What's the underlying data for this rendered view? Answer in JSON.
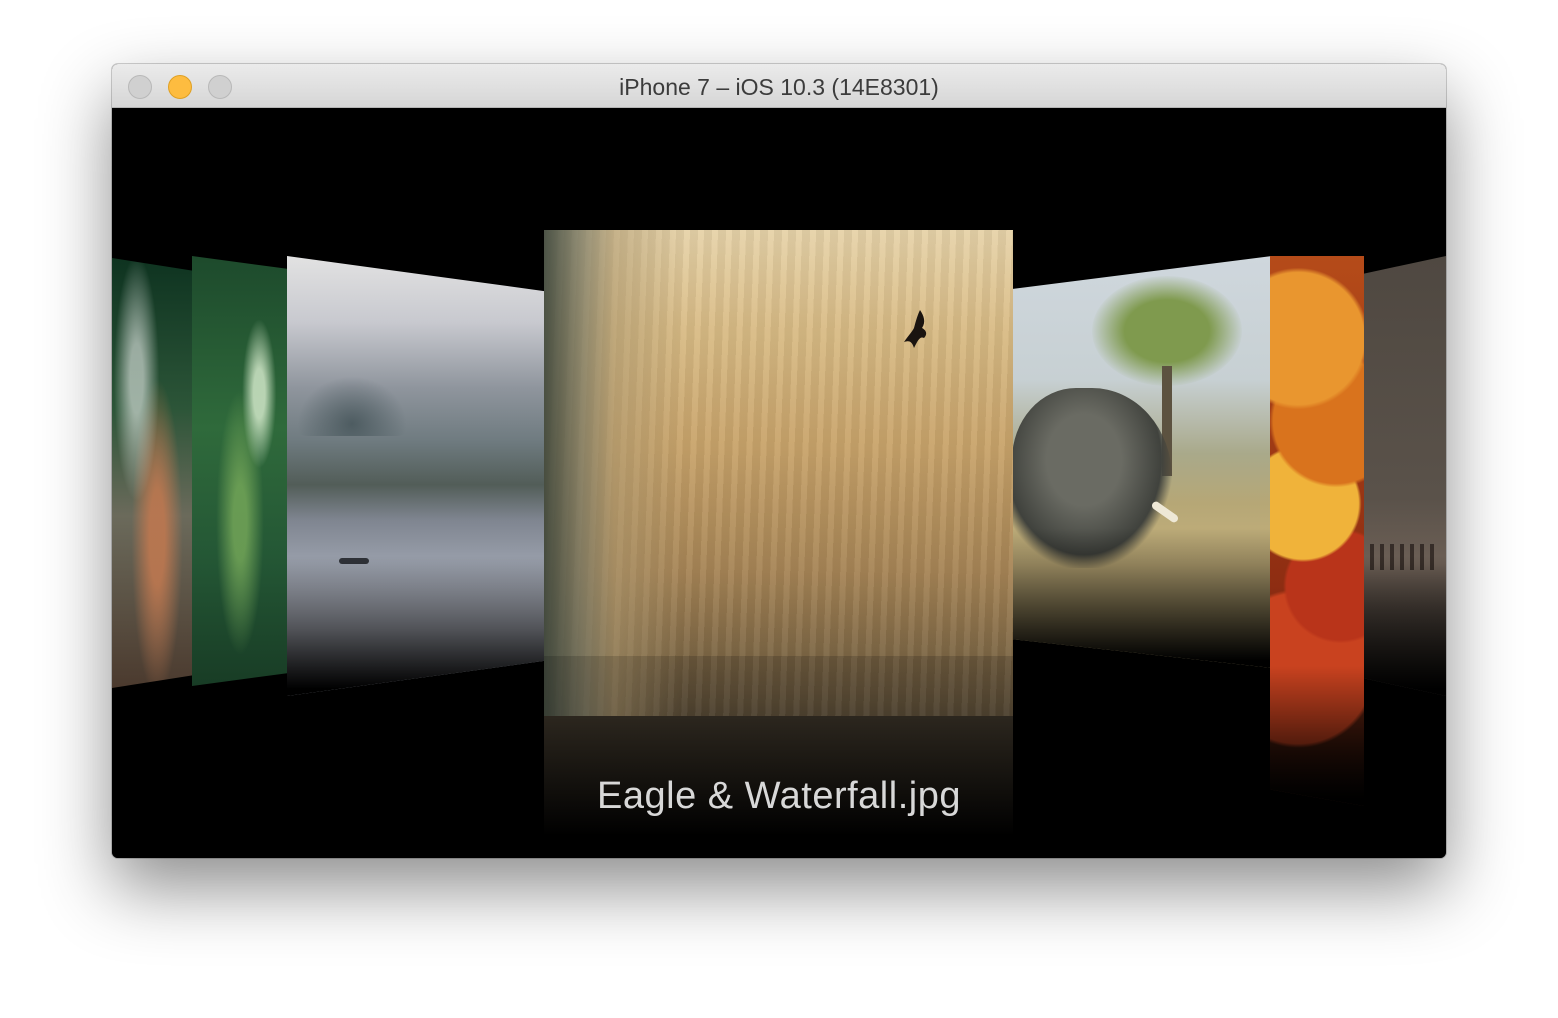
{
  "window": {
    "title": "iPhone 7 – iOS 10.3 (14E8301)"
  },
  "coverflow": {
    "selected_caption": "Eagle & Waterfall.jpg",
    "items": [
      {
        "name": "dandelion"
      },
      {
        "name": "green-blade"
      },
      {
        "name": "foggy-lake"
      },
      {
        "name": "eagle-waterfall"
      },
      {
        "name": "elephant"
      },
      {
        "name": "autumn-leaves"
      },
      {
        "name": "flamingos"
      }
    ]
  },
  "colors": {
    "traffic_close": "#d0d0d0",
    "traffic_min": "#fdbc40",
    "traffic_zoom": "#d0d0d0",
    "screen_bg": "#000000"
  }
}
